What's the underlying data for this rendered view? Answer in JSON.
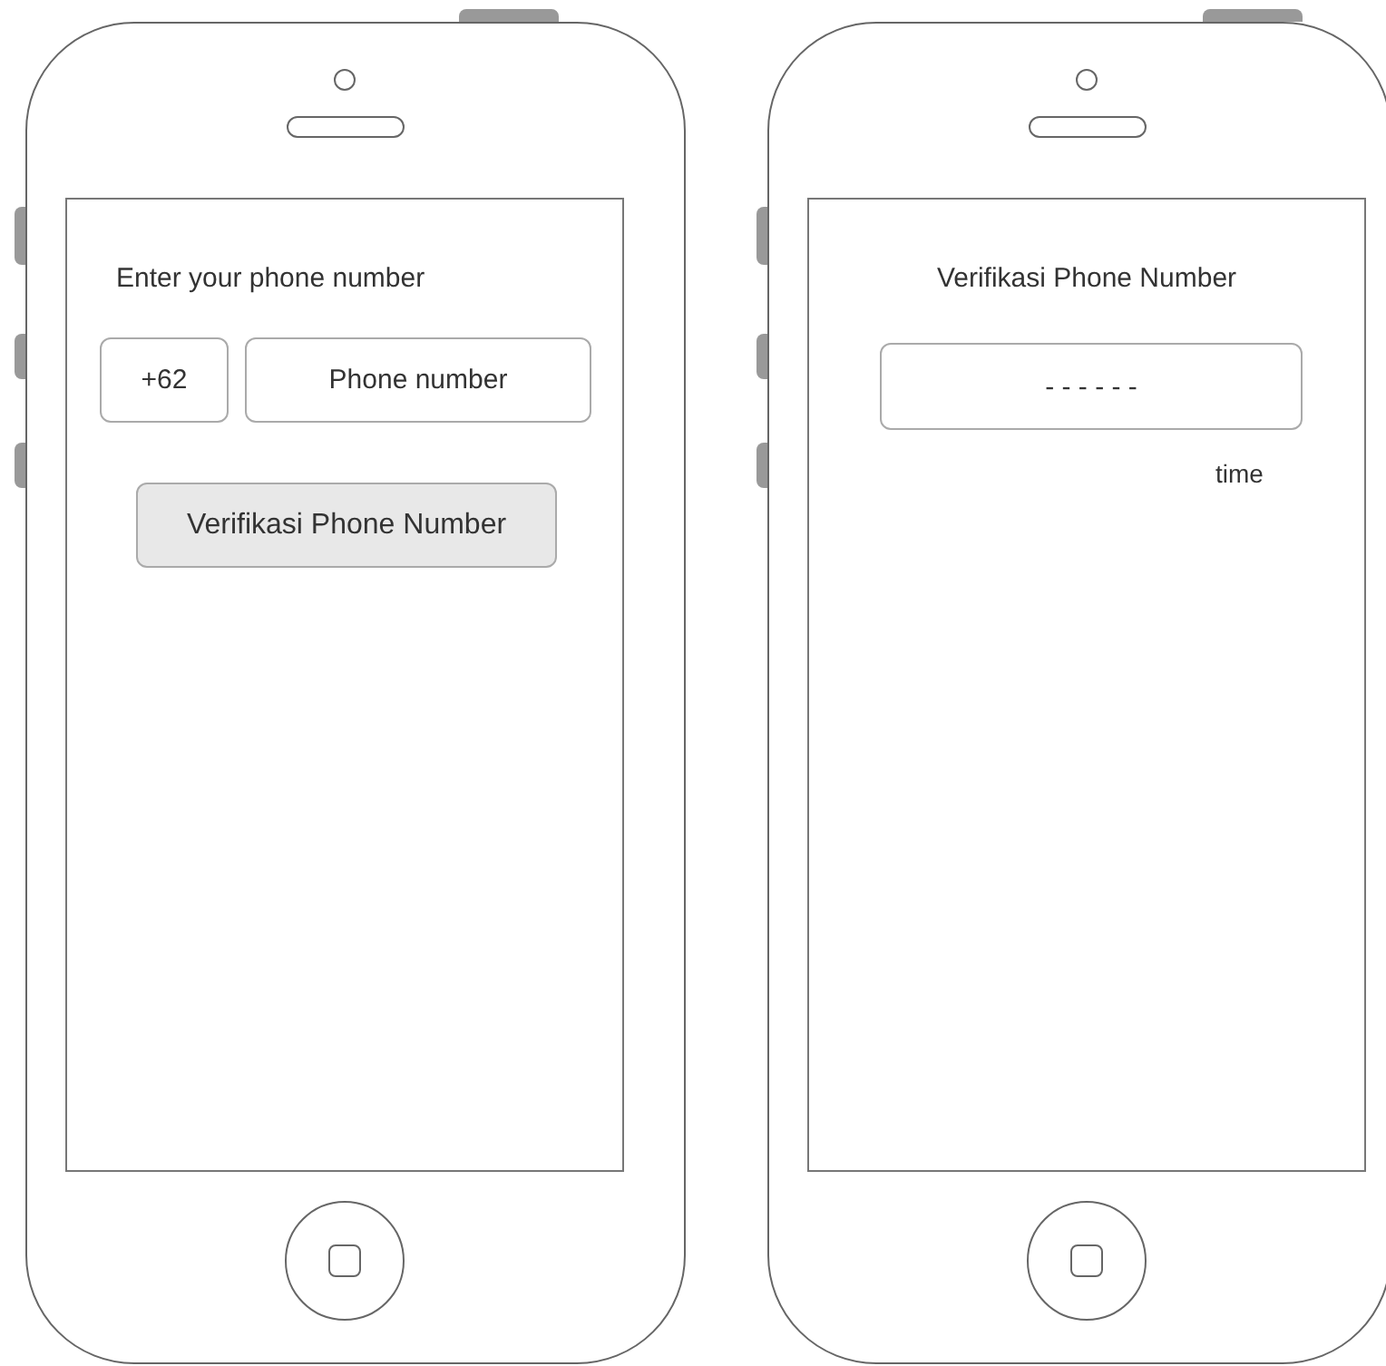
{
  "screens": [
    {
      "kind": "phone-entry",
      "title": "Enter your phone number",
      "country_code": "+62",
      "phone_placeholder": "Phone number",
      "button": "Verifikasi Phone Number"
    },
    {
      "kind": "verification",
      "title": "Verifikasi Phone Number",
      "code_placeholder": "- - - - - -",
      "timer_label": "time"
    }
  ]
}
